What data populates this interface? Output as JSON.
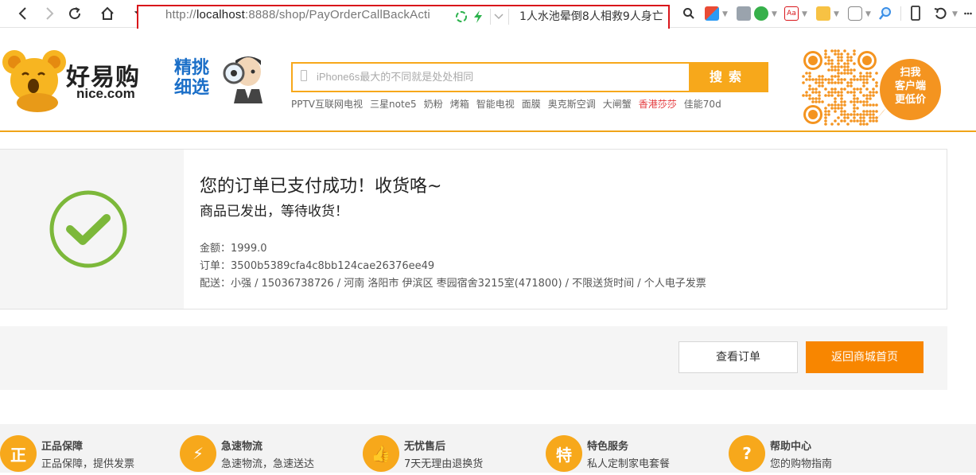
{
  "browser": {
    "url_prefix": "http://",
    "url_host": "localhost",
    "url_rest": ":8888/shop/PayOrderCallBackActi",
    "news_ticker": "1人水池晕倒8人相救9人身亡"
  },
  "site": {
    "logo_cn": "好易购",
    "logo_en": "nice.com",
    "promo_line1": "精挑",
    "promo_line2": "细选",
    "search_placeholder": "iPhone6s最大的不同就是处处相同",
    "search_button": "搜索",
    "hot_words": [
      "PPTV互联网电视",
      "三星note5",
      "奶粉",
      "烤箱",
      "智能电视",
      "面膜",
      "奥克斯空调",
      "大闸蟹",
      "香港莎莎",
      "佳能70d"
    ],
    "hot_highlight_index": 8,
    "qr_bubble_line1": "扫我",
    "qr_bubble_line2": "客户端",
    "qr_bubble_line3": "更低价"
  },
  "order": {
    "title": "您的订单已支付成功！收货咯~",
    "subtitle": "商品已发出，等待收货！",
    "amount_line": "金额：1999.0",
    "order_line": "订单：3500b5389cfa4c8bb124cae26376ee49",
    "delivery_line": "配送：小强  /  15036738726  /  河南 洛阳市 伊滨区 枣园宿舍3215室(471800)  /  不限送货时间  /  个人电子发票"
  },
  "actions": {
    "view_order": "查看订单",
    "back_home": "返回商城首页"
  },
  "footer": {
    "items": [
      {
        "icon": "正",
        "title": "正品保障",
        "desc": "正品保障，提供发票"
      },
      {
        "icon": "⚡",
        "title": "急速物流",
        "desc": "急速物流，急速送达"
      },
      {
        "icon": "👍",
        "title": "无忧售后",
        "desc": "7天无理由退换货"
      },
      {
        "icon": "特",
        "title": "特色服务",
        "desc": "私人定制家电套餐"
      },
      {
        "icon": "?",
        "title": "帮助中心",
        "desc": "您的购物指南"
      }
    ]
  },
  "colors": {
    "accent_orange": "#f7a81b",
    "button_orange": "#f88600",
    "success_green": "#7cb83a",
    "highlight_red": "#d9161b"
  }
}
